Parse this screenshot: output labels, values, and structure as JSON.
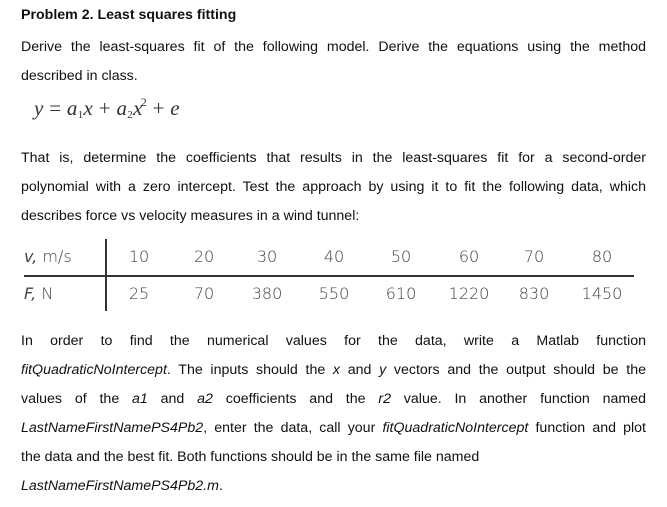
{
  "problem": {
    "title": "Problem 2. Least squares fitting",
    "intro_lines": [
      "Derive the least-squares fit of the following model. Derive the equations using the method",
      "described in class."
    ],
    "equation": {
      "lhs": "y",
      "equals": "=",
      "a1": "a",
      "a1_sub": "1",
      "x1": "x",
      "plus1": "+",
      "a2": "a",
      "a2_sub": "2",
      "x2": "x",
      "x2_sup": "2",
      "plus2": "+",
      "e": "e"
    },
    "para2_lines": [
      "That is, determine the coefficients that results in the least-squares fit for a second-order",
      "polynomial with a zero intercept. Test the approach by using it to fit the following data, which",
      "describes force vs velocity measures in a wind tunnel:"
    ]
  },
  "data_table": {
    "rows": [
      {
        "label_var": "v,",
        "label_unit": "m/s",
        "values": [
          "10",
          "20",
          "30",
          "40",
          "50",
          "60",
          "70",
          "80"
        ]
      },
      {
        "label_var": "F,",
        "label_unit": "N",
        "values": [
          "25",
          "70",
          "380",
          "550",
          "610",
          "1220",
          "830",
          "1450"
        ]
      }
    ]
  },
  "instructions": {
    "line1": "In order to find the numerical values for the data, write a Matlab function",
    "line2_fn": "fitQuadraticNoIntercept",
    "line2_a": ". The inputs should the ",
    "line2_x": "x",
    "line2_b": " and ",
    "line2_y": "y",
    "line2_c": " vectors and the output should be the",
    "line3_a": "values of the ",
    "line3_a1": "a1",
    "line3_b": " and ",
    "line3_a2": "a2",
    "line3_c": " coefficients and the ",
    "line3_r2": "r2",
    "line3_d": " value. In another function named",
    "line4_name": "LastNameFirstNamePS4Pb2",
    "line4_a": ", enter the data, call your ",
    "line4_fn": "fitQuadraticNoIntercept",
    "line4_b": " function and plot",
    "line5": "the data and the best fit. Both functions should be in the same file named",
    "line6_file": "LastNameFirstNamePS4Pb2.m",
    "line6_end": "."
  }
}
